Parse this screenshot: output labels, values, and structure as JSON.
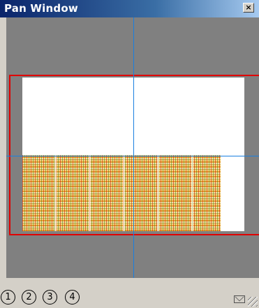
{
  "window": {
    "title": "Pan Window",
    "close_label": "×"
  },
  "view_buttons": [
    {
      "label": "1"
    },
    {
      "label": "2"
    },
    {
      "label": "3"
    },
    {
      "label": "4"
    }
  ],
  "colors": {
    "titlebar": "#0a246a",
    "viewport_background": "#808080",
    "view_frame": "#e00000",
    "crosshair": "#1a7fe0"
  },
  "icons": {
    "close": "close-icon",
    "mail": "mail-icon",
    "resize": "resize-grip-icon"
  }
}
